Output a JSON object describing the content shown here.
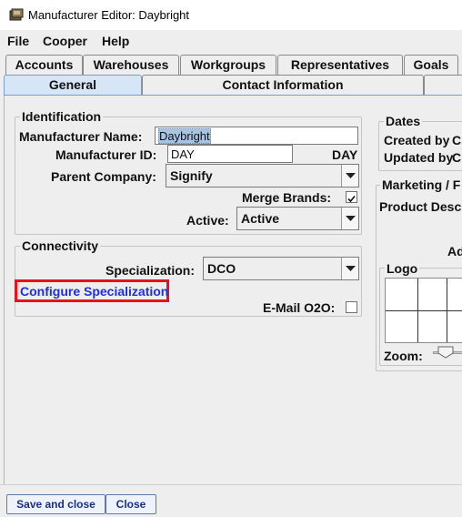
{
  "window": {
    "title": "Manufacturer Editor: Daybright"
  },
  "menu": [
    "File",
    "Cooper",
    "Help"
  ],
  "tabs_row1": [
    "Accounts",
    "Warehouses",
    "Workgroups",
    "Representatives",
    "Goals"
  ],
  "tabs_row2": [
    "General",
    "Contact Information"
  ],
  "identification": {
    "title": "Identification",
    "manufacturer_name_label": "Manufacturer Name:",
    "manufacturer_name_value": "Daybright",
    "manufacturer_id_label": "Manufacturer ID:",
    "manufacturer_id_value": "DAY",
    "manufacturer_id_echo": "DAY",
    "parent_company_label": "Parent Company:",
    "parent_company_value": "Signify",
    "merge_brands_label": "Merge Brands:",
    "merge_brands_checked": true,
    "active_label": "Active:",
    "active_value": "Active"
  },
  "connectivity": {
    "title": "Connectivity",
    "specialization_label": "Specialization:",
    "specialization_value": "DCO",
    "configure_link": "Configure Specialization",
    "email_o2o_label": "E-Mail O2O:",
    "email_o2o_checked": false
  },
  "dates": {
    "title": "Dates",
    "created_by_label": "Created by",
    "created_by_value": "C",
    "updated_by_label": "Updated by",
    "updated_by_value": "C"
  },
  "marketing": {
    "title": "Marketing / F",
    "product_desc_label": "Product Desc",
    "ad_label": "Ad",
    "logo_title": "Logo",
    "zoom_label": "Zoom:"
  },
  "buttons": {
    "save_close": "Save and close",
    "close": "Close"
  },
  "colors": {
    "highlight_box": "#e8121b",
    "link": "#1f2fe0",
    "selected_tab": "#d7e6f7"
  }
}
